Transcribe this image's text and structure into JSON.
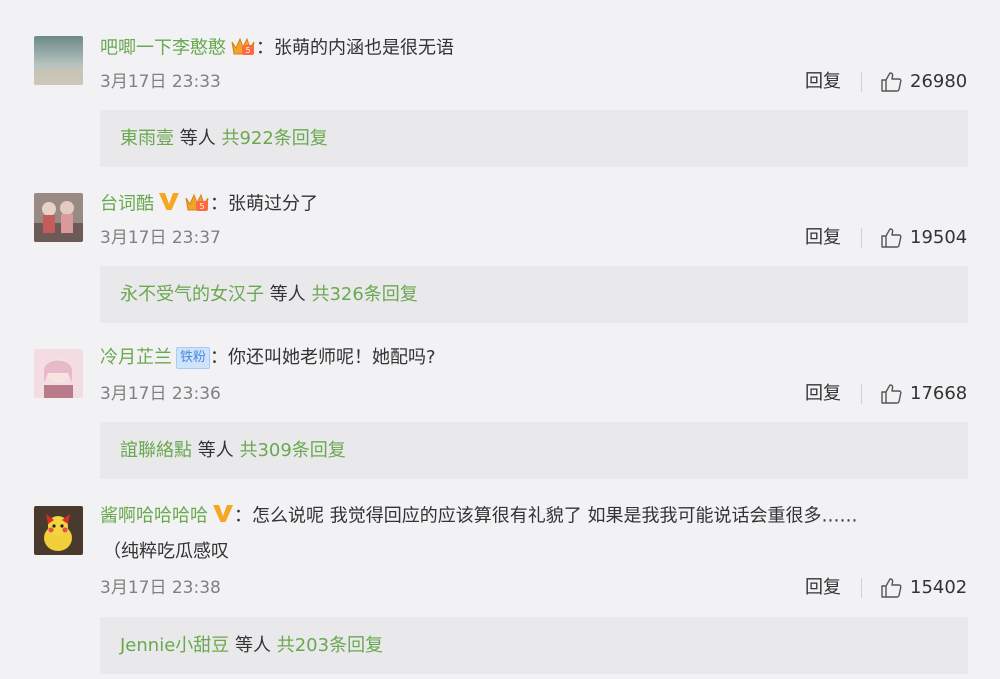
{
  "comments": [
    {
      "username": "吧唧一下李憨憨",
      "text": "张萌的内涵也是很无语",
      "date": "3月17日 23:33",
      "reply_label": "回复",
      "likes": "26980",
      "reply_summary": {
        "names": "東雨壹",
        "mid": " 等人 ",
        "count": "共922条回复"
      }
    },
    {
      "username": "台词酷",
      "text": "张萌过分了",
      "date": "3月17日 23:37",
      "reply_label": "回复",
      "likes": "19504",
      "reply_summary": {
        "names": "永不受气的女汉子",
        "mid": " 等人 ",
        "count": "共326条回复"
      }
    },
    {
      "username": "冷月芷兰",
      "fan_badge": "铁粉",
      "text": "你还叫她老师呢！她配吗?",
      "date": "3月17日 23:36",
      "reply_label": "回复",
      "likes": "17668",
      "reply_summary": {
        "names": "誼聯絡點",
        "mid": " 等人 ",
        "count": "共309条回复"
      }
    },
    {
      "username": "酱啊哈哈哈哈",
      "text": "怎么说呢 我觉得回应的应该算很有礼貌了 如果是我我可能说话会重很多……",
      "text2": "（纯粹吃瓜感叹",
      "date": "3月17日 23:38",
      "reply_label": "回复",
      "likes": "15402",
      "reply_summary": {
        "names": "Jennie小甜豆",
        "mid": " 等人 ",
        "count": "共203条回复"
      }
    }
  ],
  "colors": {
    "username": "#6aa84f",
    "date": "#808080",
    "background": "#f2f2f5",
    "reply_box": "#e9e9ec"
  },
  "colon": "："
}
